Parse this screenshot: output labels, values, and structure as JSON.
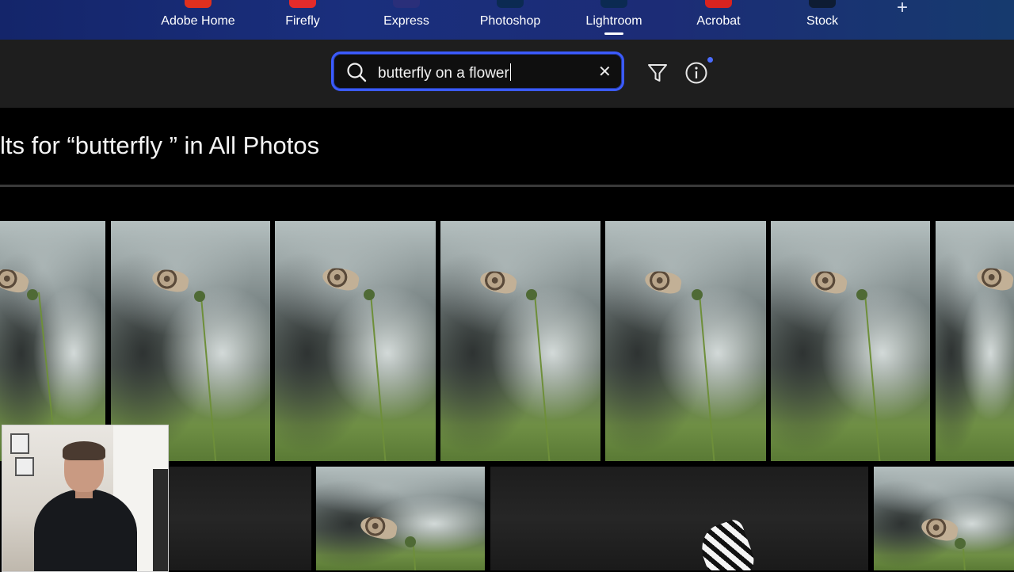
{
  "appbar": {
    "apps": [
      {
        "label": "Adobe Home",
        "logo_color": "#e0301e"
      },
      {
        "label": "Firefly",
        "logo_color": "#e32b2b"
      },
      {
        "label": "Express",
        "logo_color": "#2a2f7a"
      },
      {
        "label": "Photoshop",
        "logo_color": "#0b2a52"
      },
      {
        "label": "Lightroom",
        "logo_color": "#0b2a52",
        "active": true
      },
      {
        "label": "Acrobat",
        "logo_color": "#d9231f"
      },
      {
        "label": "Stock",
        "logo_color": "#0e1c33"
      }
    ],
    "add_icon": "plus-icon"
  },
  "search": {
    "value": "butterfly on a flower",
    "icon": "search-icon",
    "clear_icon": "close-icon",
    "clear_glyph": "✕",
    "accent": "#3b5bff"
  },
  "toolbar": {
    "filter_icon": "filter-icon",
    "info_icon": "info-icon"
  },
  "results": {
    "title": "lts for “butterfly ” in All Photos"
  },
  "colors": {
    "appbar": "#1a2f7d",
    "search_row": "#1e1e1e",
    "background": "#000000"
  },
  "webcam": {
    "subject": "presenter webcam"
  }
}
